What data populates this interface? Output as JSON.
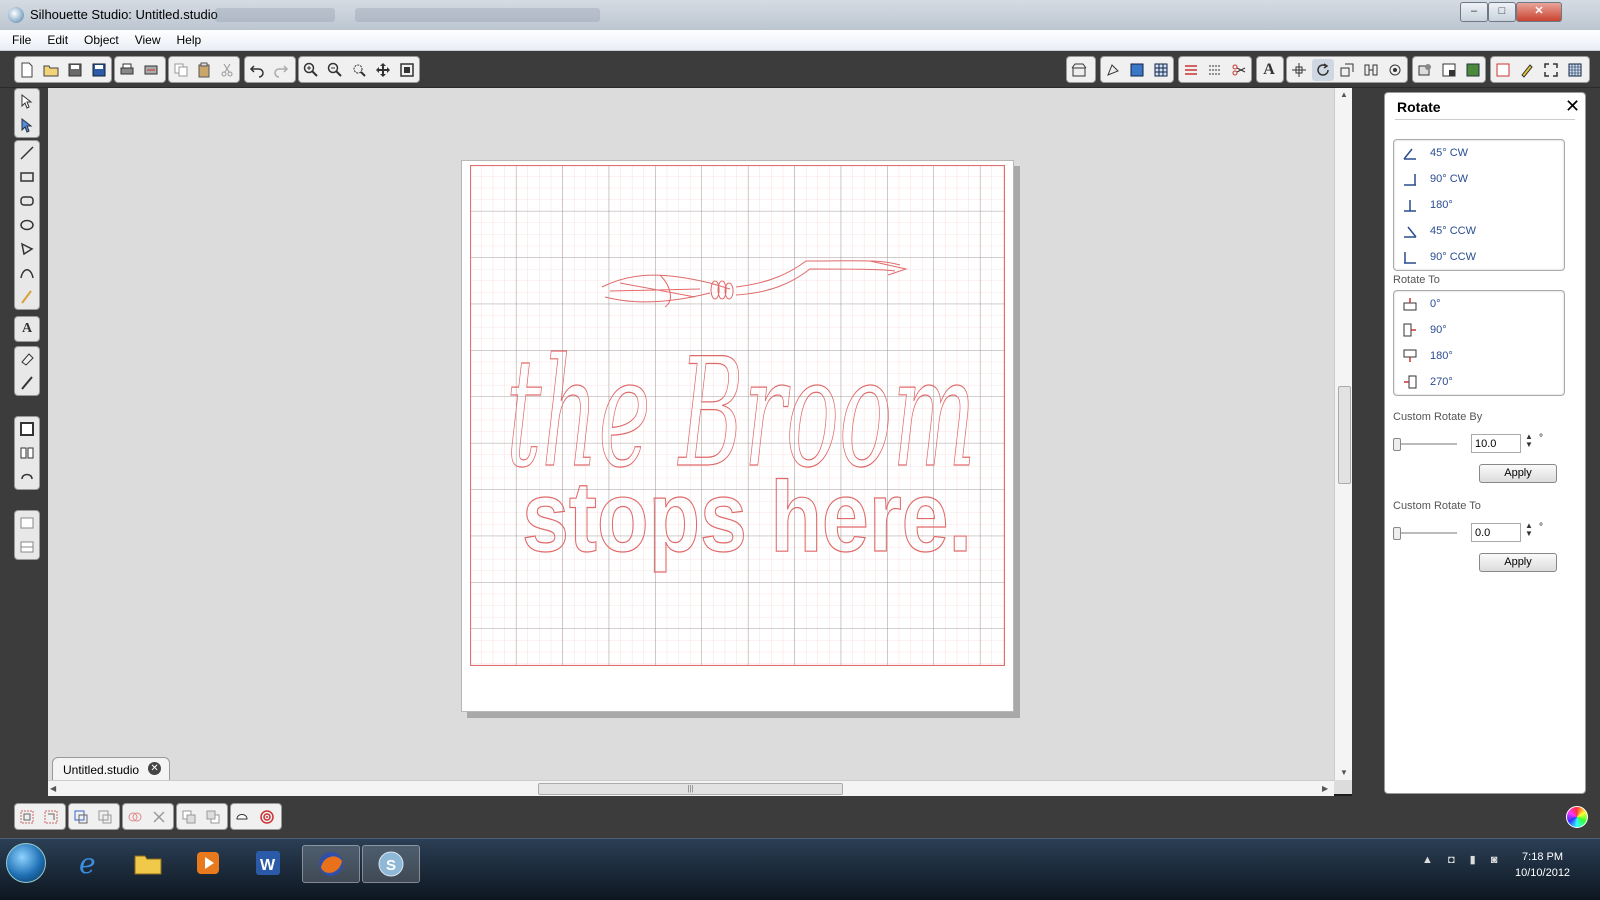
{
  "window": {
    "title": "Silhouette Studio: Untitled.studio",
    "controls": [
      "–",
      "□",
      "✕"
    ]
  },
  "menu": [
    "File",
    "Edit",
    "Object",
    "View",
    "Help"
  ],
  "document": {
    "tab_label": "Untitled.studio",
    "canvas_text_line1": "the Broom",
    "canvas_text_line2": "stops here."
  },
  "panel": {
    "title": "Rotate",
    "rotate_by": [
      {
        "label": "45° CW",
        "icon": "rotate-45-cw-icon"
      },
      {
        "label": "90° CW",
        "icon": "rotate-90-cw-icon"
      },
      {
        "label": "180°",
        "icon": "rotate-180-icon"
      },
      {
        "label": "45° CCW",
        "icon": "rotate-45-ccw-icon"
      },
      {
        "label": "90° CCW",
        "icon": "rotate-90-ccw-icon"
      }
    ],
    "rotate_to_label": "Rotate To",
    "rotate_to": [
      {
        "label": "0°",
        "icon": "rotate-to-0-icon"
      },
      {
        "label": "90°",
        "icon": "rotate-to-90-icon"
      },
      {
        "label": "180°",
        "icon": "rotate-to-180-icon"
      },
      {
        "label": "270°",
        "icon": "rotate-to-270-icon"
      }
    ],
    "custom_by": {
      "label": "Custom Rotate By",
      "value": "10.0",
      "unit": "°",
      "apply": "Apply"
    },
    "custom_to": {
      "label": "Custom Rotate To",
      "value": "0.0",
      "unit": "°",
      "apply": "Apply"
    }
  },
  "taskbar": {
    "time": "7:18 PM",
    "date": "10/10/2012",
    "apps": [
      "internet-explorer-icon",
      "file-explorer-icon",
      "media-player-icon",
      "word-icon",
      "firefox-icon",
      "silhouette-studio-icon"
    ]
  },
  "colors": {
    "cut_line": "#e06a6a",
    "panel_link": "#2a4c90",
    "chrome_dark": "#3c3c3c"
  }
}
